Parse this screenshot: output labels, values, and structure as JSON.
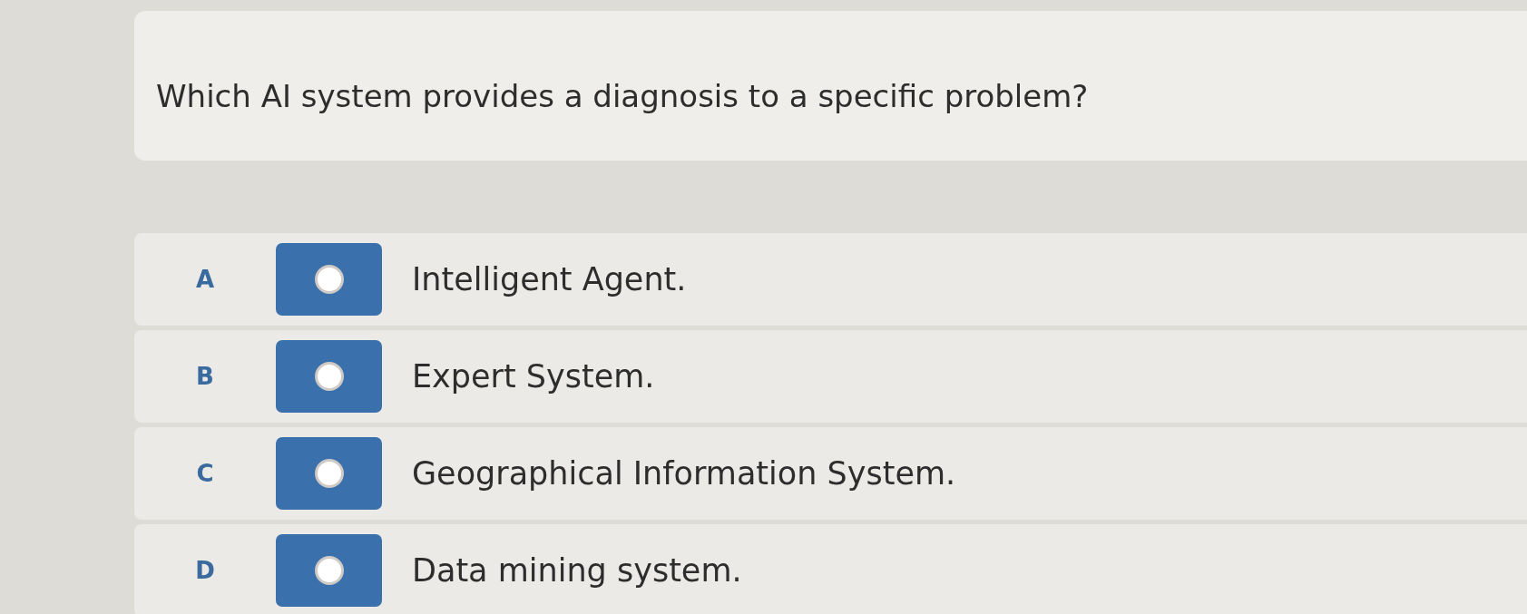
{
  "question": {
    "text": "Which AI system provides a diagnosis to a specific problem?"
  },
  "options": [
    {
      "letter": "A",
      "label": "Intelligent Agent.",
      "selected": false
    },
    {
      "letter": "B",
      "label": "Expert System.",
      "selected": false
    },
    {
      "letter": "C",
      "label": "Geographical Information System.",
      "selected": false
    },
    {
      "letter": "D",
      "label": "Data mining system.",
      "selected": false
    }
  ]
}
